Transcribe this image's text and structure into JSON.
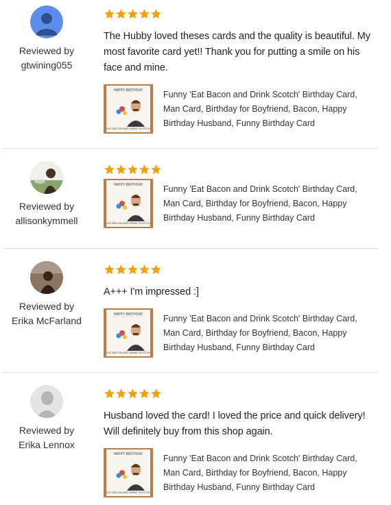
{
  "accent": {
    "star": "#f1a10e",
    "divider": "#dcdcdc"
  },
  "reviews": [
    {
      "reviewed_by_label": "Reviewed by",
      "reviewer": "gtwining055",
      "avatar": "default-google-avatar",
      "rating": 5,
      "text": "The Hubby loved theses cards and the quality is beautiful. My most favorite card yet!! Thank you for putting a smile on his face and mine.",
      "item_title": "Funny 'Eat Bacon and Drink Scotch' Birthday Card, Man Card, Birthday for Boyfriend, Bacon, Happy Birthday Husband, Funny Birthday Card"
    },
    {
      "reviewed_by_label": "Reviewed by",
      "reviewer": "allisonkymmell",
      "avatar": "photo-avatar",
      "rating": 5,
      "text": "",
      "item_title": "Funny 'Eat Bacon and Drink Scotch' Birthday Card, Man Card, Birthday for Boyfriend, Bacon, Happy Birthday Husband, Funny Birthday Card"
    },
    {
      "reviewed_by_label": "Reviewed by",
      "reviewer": "Erika McFarland",
      "avatar": "photo-avatar",
      "rating": 5,
      "text": "A+++ I'm impressed :]",
      "item_title": "Funny 'Eat Bacon and Drink Scotch' Birthday Card, Man Card, Birthday for Boyfriend, Bacon, Happy Birthday Husband, Funny Birthday Card"
    },
    {
      "reviewed_by_label": "Reviewed by",
      "reviewer": "Erika Lennox",
      "avatar": "silhouette-avatar",
      "rating": 5,
      "text": "Husband loved the card! I loved the price and quick delivery! Will definitely buy from this shop again.",
      "item_title": "Funny 'Eat Bacon and Drink Scotch' Birthday Card, Man Card, Birthday for Boyfriend, Bacon, Happy Birthday Husband, Funny Birthday Card"
    }
  ],
  "card_thumb": {
    "top_text": "HAPPY BIRTHDAY",
    "bottom_text": "EAT BACON AND DRINK SCOTCH"
  }
}
